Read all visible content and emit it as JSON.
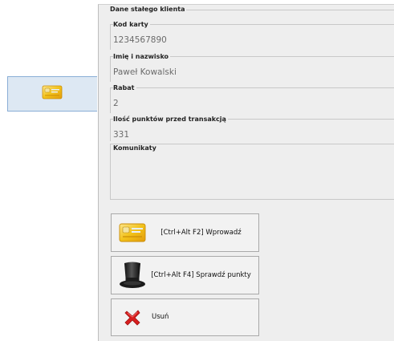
{
  "customer_panel": {
    "title": "Dane stałego klienta",
    "card_code": {
      "label": "Kod karty",
      "value": "1234567890"
    },
    "name": {
      "label": "Imię i nazwisko",
      "value": "Paweł Kowalski"
    },
    "discount": {
      "label": "Rabat",
      "value": "2"
    },
    "points": {
      "label": "Ilość punktów przed transakcją",
      "value": "331"
    },
    "messages": {
      "label": "Komunikaty",
      "value": ""
    }
  },
  "buttons": {
    "enter": {
      "label": "[Ctrl+Alt F2] Wprowadź",
      "icon": "loyalty-card-icon"
    },
    "check_points": {
      "label": "[Ctrl+Alt F4] Sprawdź punkty",
      "icon": "top-hat-icon"
    },
    "delete": {
      "label": "Usuń",
      "icon": "red-x-icon"
    }
  },
  "left_tab": {
    "icon": "loyalty-card-icon"
  },
  "colors": {
    "panel_bg": "#eeeeee",
    "tab_bg": "#dde8f3",
    "card_gold": "#f2c21a",
    "delete_red": "#d81e1e"
  }
}
